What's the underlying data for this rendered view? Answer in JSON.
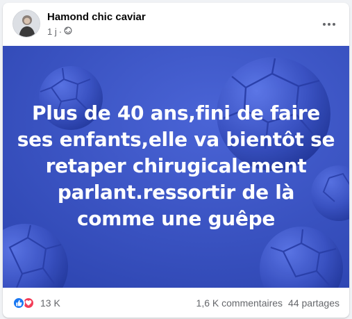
{
  "post": {
    "author": "Hamond chic caviar",
    "time": "1 j",
    "separator": "·",
    "privacy_icon": "public-globe-icon",
    "more_icon": "more-options-icon"
  },
  "image": {
    "background_color": "#3b56c4",
    "text": "Plus de 40 ans,fini de faire ses enfants,elle va bientôt se retaper chirugicalement parlant.ressortir de là comme une guêpe"
  },
  "footer": {
    "reaction_icons": [
      "like-icon",
      "love-icon"
    ],
    "reaction_count": "13 K",
    "comments": "1,6 K commentaires",
    "shares": "44 partages"
  },
  "colors": {
    "like": "#1877f2",
    "love": "#f33e58",
    "text_secondary": "#65676b"
  }
}
